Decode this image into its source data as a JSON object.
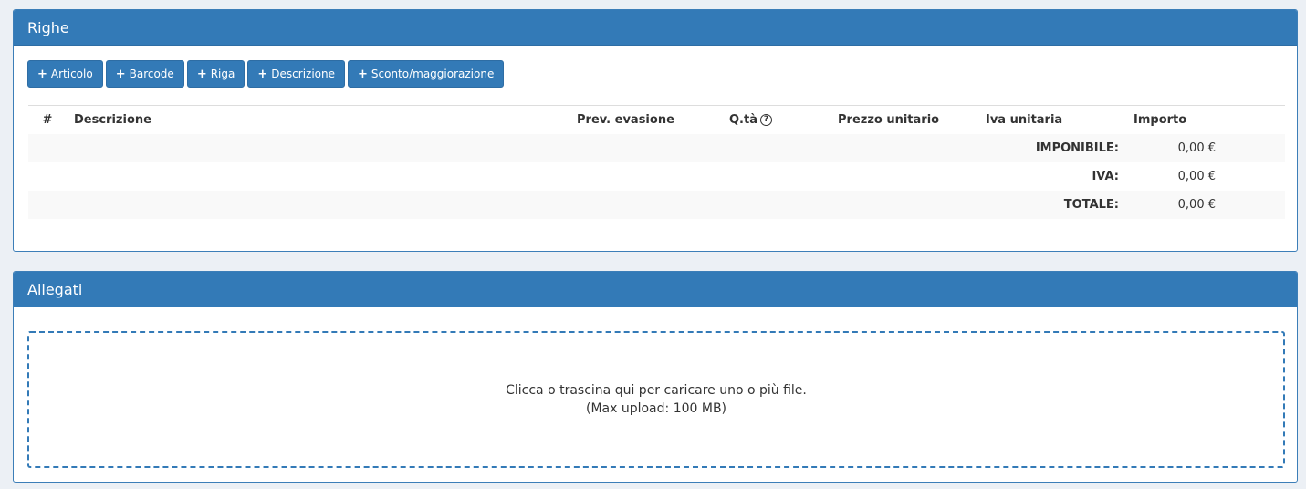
{
  "righe": {
    "title": "Righe",
    "buttons": [
      {
        "label": "Articolo"
      },
      {
        "label": "Barcode"
      },
      {
        "label": "Riga"
      },
      {
        "label": "Descrizione"
      },
      {
        "label": "Sconto/maggiorazione"
      }
    ],
    "table": {
      "headers": {
        "num": "#",
        "descrizione": "Descrizione",
        "prev_evasione": "Prev. evasione",
        "qta": "Q.tà",
        "prezzo_unitario": "Prezzo unitario",
        "iva_unitaria": "Iva unitaria",
        "importo": "Importo"
      },
      "totals": [
        {
          "label": "IMPONIBILE:",
          "value": "0,00 €"
        },
        {
          "label": "IVA:",
          "value": "0,00 €"
        },
        {
          "label": "TOTALE:",
          "value": "0,00 €"
        }
      ]
    }
  },
  "allegati": {
    "title": "Allegati",
    "dropzone_line1": "Clicca o trascina qui per caricare uno o più file.",
    "dropzone_line2": "(Max upload: 100 MB)"
  },
  "icons": {
    "plus": "+",
    "help": "?"
  },
  "colors": {
    "primary": "#337ab7",
    "primary_border": "#2e6da4",
    "page_bg": "#ecf0f5"
  }
}
